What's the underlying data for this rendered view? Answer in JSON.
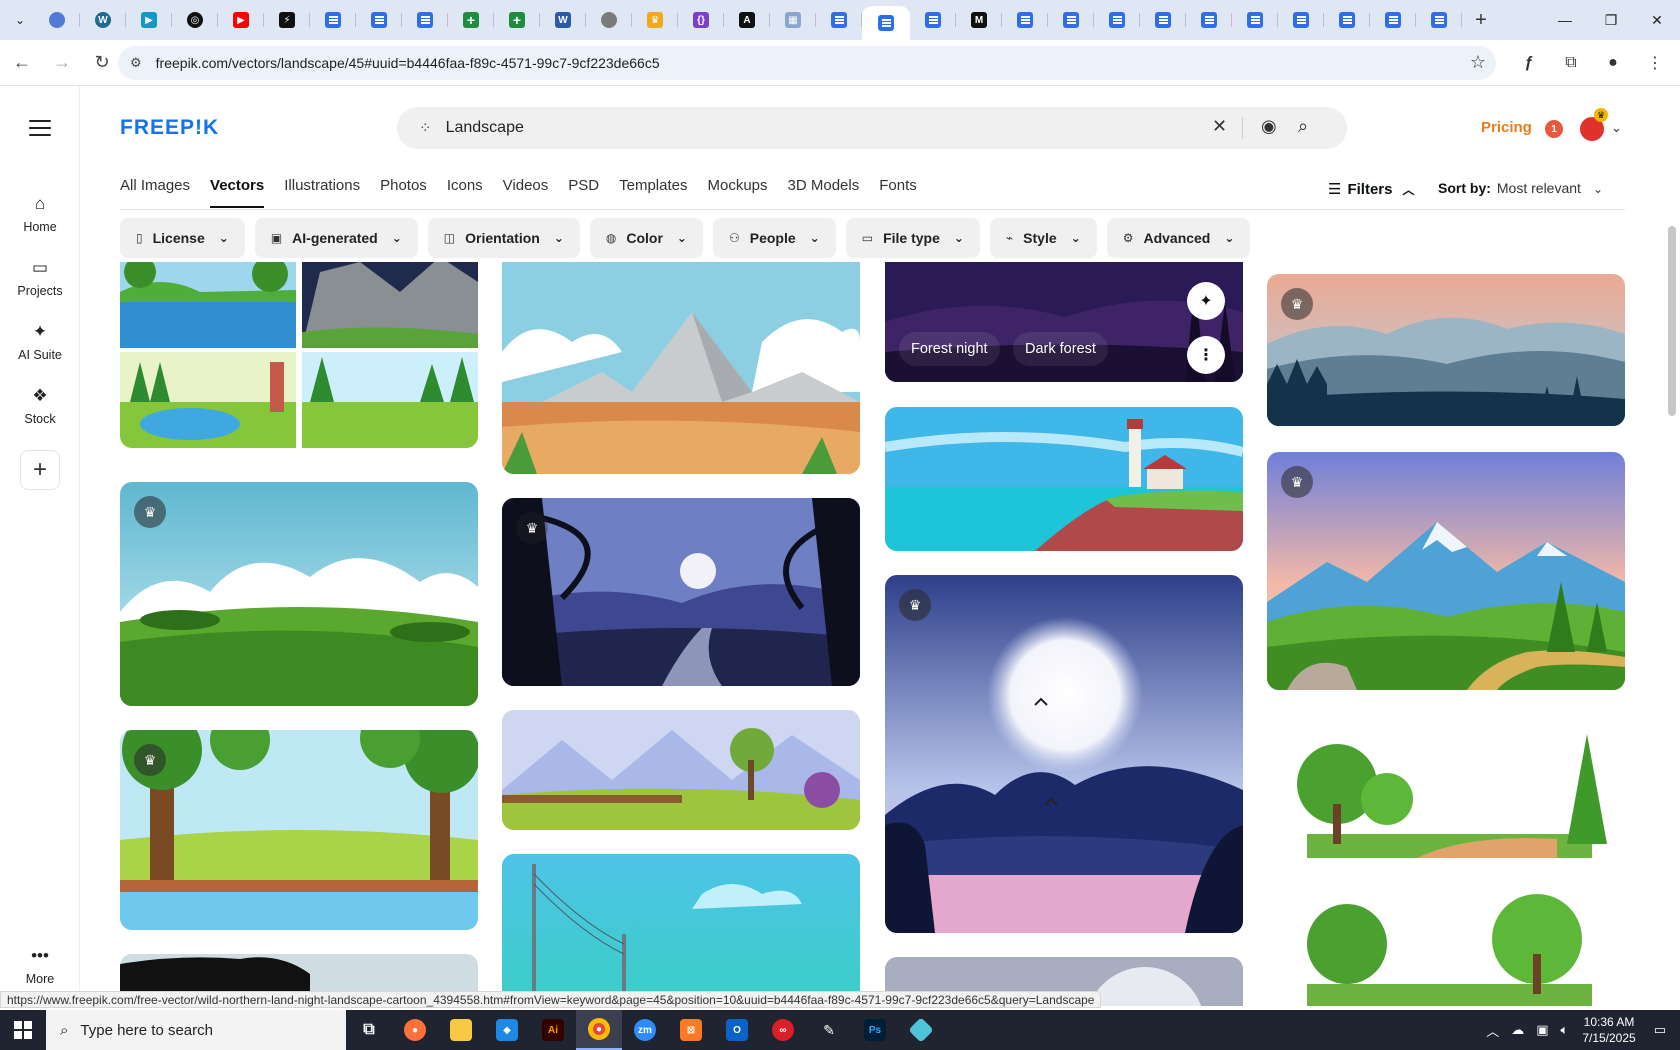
{
  "browser": {
    "tab_favicons": [
      {
        "icon": "globe-icon",
        "color": "#4f7bd6",
        "round": true,
        "glyph": ""
      },
      {
        "icon": "wordpress-icon",
        "color": "#1b6c8f",
        "round": true,
        "glyph": "W"
      },
      {
        "icon": "app-icon",
        "color": "#1496c8",
        "round": false,
        "glyph": "▶"
      },
      {
        "icon": "openai-icon",
        "color": "#111111",
        "round": true,
        "glyph": "◎"
      },
      {
        "icon": "youtube-icon",
        "color": "#ff0000",
        "round": false,
        "glyph": "▶"
      },
      {
        "icon": "bolt-icon",
        "color": "#111111",
        "round": false,
        "glyph": "⚡"
      },
      {
        "icon": "docs-icon",
        "kind": "doc"
      },
      {
        "icon": "docs-icon",
        "kind": "doc"
      },
      {
        "icon": "docs-icon",
        "kind": "doc"
      },
      {
        "icon": "sheets-icon",
        "kind": "sheet"
      },
      {
        "icon": "sheets-icon",
        "kind": "sheet"
      },
      {
        "icon": "word-icon",
        "color": "#2b5aa8",
        "round": false,
        "glyph": "W"
      },
      {
        "icon": "globe-icon",
        "color": "#7a7a7a",
        "round": true,
        "glyph": ""
      },
      {
        "icon": "crown-icon",
        "color": "#f2a81d",
        "round": false,
        "glyph": "♛"
      },
      {
        "icon": "code-icon",
        "color": "#7c3fc9",
        "round": false,
        "glyph": "{}"
      },
      {
        "icon": "letter-a-icon",
        "color": "#111111",
        "round": false,
        "glyph": "A"
      },
      {
        "icon": "grid-icon",
        "color": "#8aa6cf",
        "round": false,
        "glyph": "▦"
      },
      {
        "icon": "docs-icon",
        "kind": "doc"
      },
      {
        "icon": "docs-icon",
        "kind": "doc",
        "active": true
      },
      {
        "icon": "docs-icon",
        "kind": "doc"
      },
      {
        "icon": "medium-icon",
        "color": "#111111",
        "round": false,
        "glyph": "M"
      },
      {
        "icon": "docs-icon",
        "kind": "doc"
      },
      {
        "icon": "docs-icon",
        "kind": "doc"
      },
      {
        "icon": "docs-icon",
        "kind": "doc"
      },
      {
        "icon": "docs-icon",
        "kind": "doc"
      },
      {
        "icon": "docs-icon",
        "kind": "doc"
      },
      {
        "icon": "docs-icon",
        "kind": "doc"
      },
      {
        "icon": "docs-icon",
        "kind": "doc"
      },
      {
        "icon": "docs-icon",
        "kind": "doc"
      },
      {
        "icon": "docs-icon",
        "kind": "doc"
      },
      {
        "icon": "docs-icon",
        "kind": "doc"
      }
    ],
    "url": "freepik.com/vectors/landscape/45#uuid=b4446faa-f89c-4571-99c7-9cf223de66c5",
    "status_url": "https://www.freepik.com/free-vector/wild-northern-land-night-landscape-cartoon_4394558.htm#fromView=keyword&page=45&position=10&uuid=b4446faa-f89c-4571-99c7-9cf223de66c5&query=Landscape"
  },
  "rail": {
    "items": [
      {
        "label": "Home",
        "icon": "home-icon"
      },
      {
        "label": "Projects",
        "icon": "projects-icon"
      },
      {
        "label": "AI Suite",
        "icon": "sparkle-icon"
      },
      {
        "label": "Stock",
        "icon": "stock-icon"
      }
    ],
    "more_label": "More"
  },
  "header": {
    "logo": "FREEP!K",
    "search_value": "Landscape",
    "pricing_label": "Pricing",
    "notification_count": "1",
    "brand_color": "#1273eb",
    "pricing_color": "#ec7a16"
  },
  "categories": [
    "All Images",
    "Vectors",
    "Illustrations",
    "Photos",
    "Icons",
    "Videos",
    "PSD",
    "Templates",
    "Mockups",
    "3D Models",
    "Fonts"
  ],
  "active_category": "Vectors",
  "filters_label": "Filters",
  "sort": {
    "label": "Sort by:",
    "value": "Most relevant"
  },
  "chips": [
    {
      "label": "License",
      "icon": "license-icon"
    },
    {
      "label": "AI-generated",
      "icon": "ai-icon"
    },
    {
      "label": "Orientation",
      "icon": "orientation-icon"
    },
    {
      "label": "Color",
      "icon": "palette-icon"
    },
    {
      "label": "People",
      "icon": "people-icon"
    },
    {
      "label": "File type",
      "icon": "file-icon"
    },
    {
      "label": "Style",
      "icon": "brush-icon"
    },
    {
      "label": "Advanced",
      "icon": "gear-icon"
    }
  ],
  "gallery": {
    "hover_tags": [
      "Forest night",
      "Dark forest"
    ]
  },
  "taskbar": {
    "search_placeholder": "Type here to search",
    "time": "10:36 AM",
    "date": "7/15/2025"
  }
}
